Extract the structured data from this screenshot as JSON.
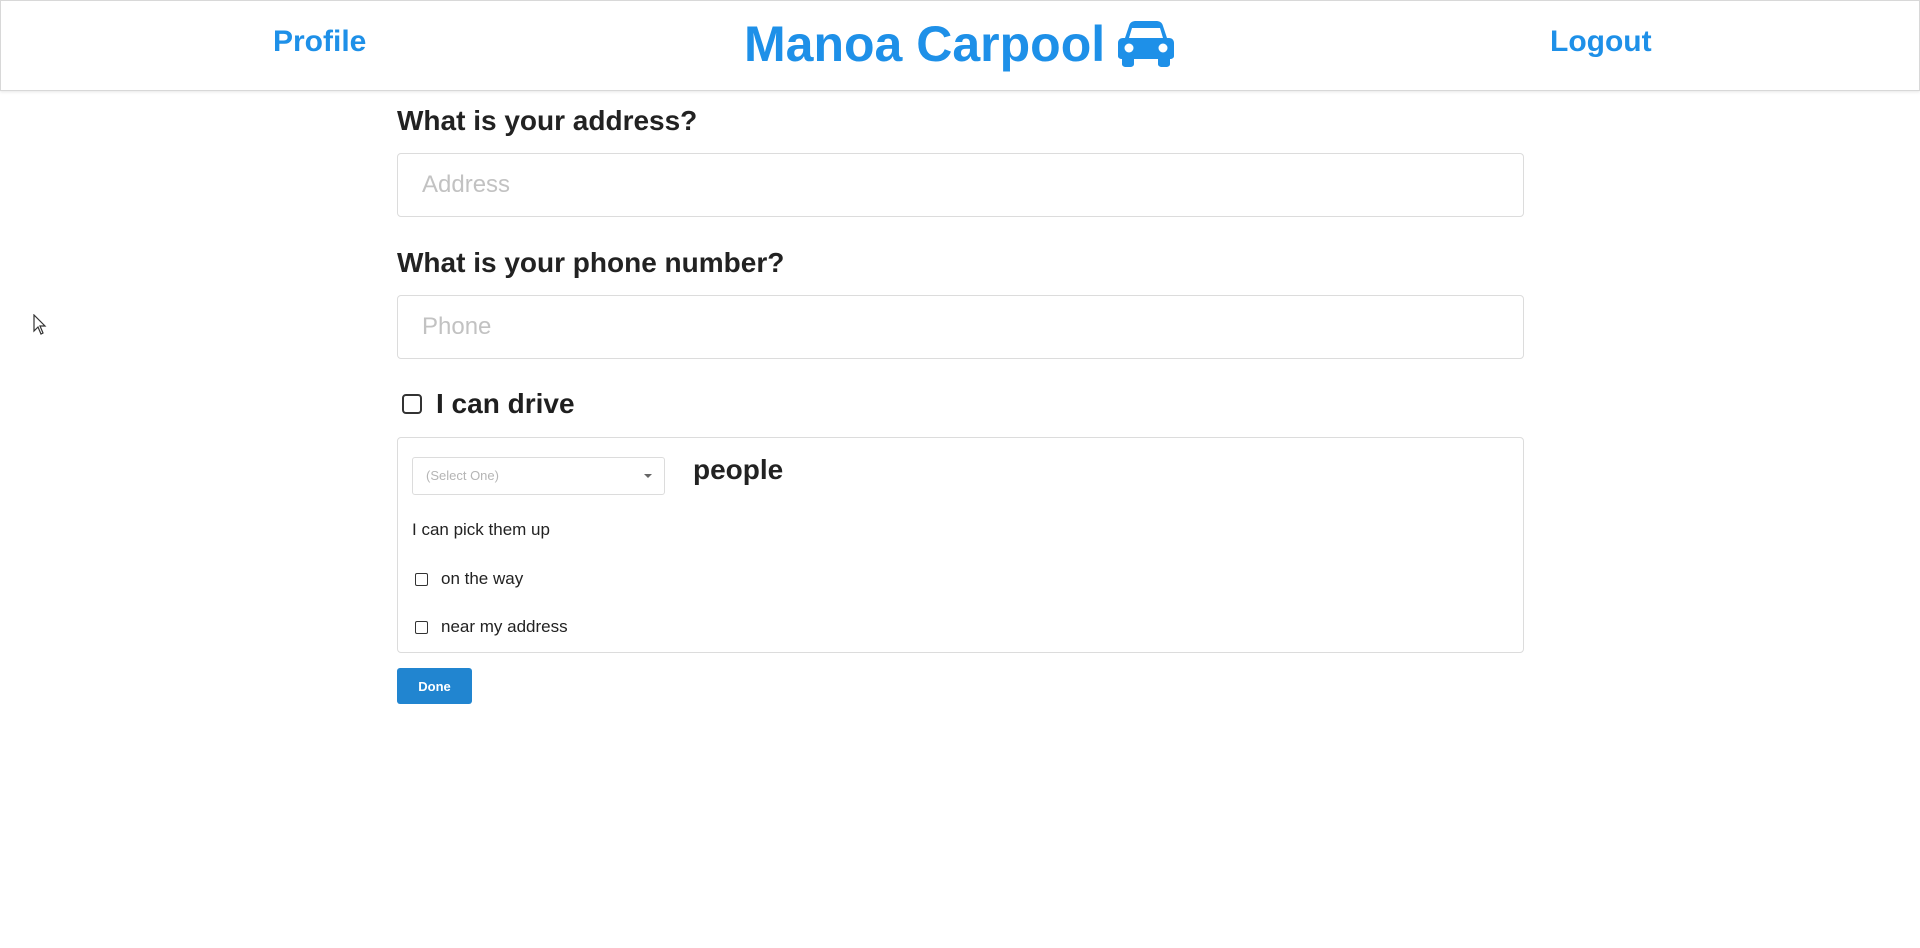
{
  "header": {
    "profile_label": "Profile",
    "title": "Manoa Carpool",
    "logout_label": "Logout",
    "brand_icon": "car-icon",
    "brand_color": "#1e90e8"
  },
  "form": {
    "address_question": "What is your address?",
    "address_placeholder": "Address",
    "address_value": "",
    "phone_question": "What is your phone number?",
    "phone_placeholder": "Phone",
    "phone_value": "",
    "can_drive_label": "I can drive",
    "can_drive_checked": false,
    "capacity_select_value": "(Select One)",
    "capacity_unit": "people",
    "pickup_label": "I can pick them up",
    "pickup_options": [
      {
        "label": "on the way",
        "checked": false
      },
      {
        "label": "near my address",
        "checked": false
      }
    ],
    "done_label": "Done",
    "done_color": "#2185d0"
  }
}
